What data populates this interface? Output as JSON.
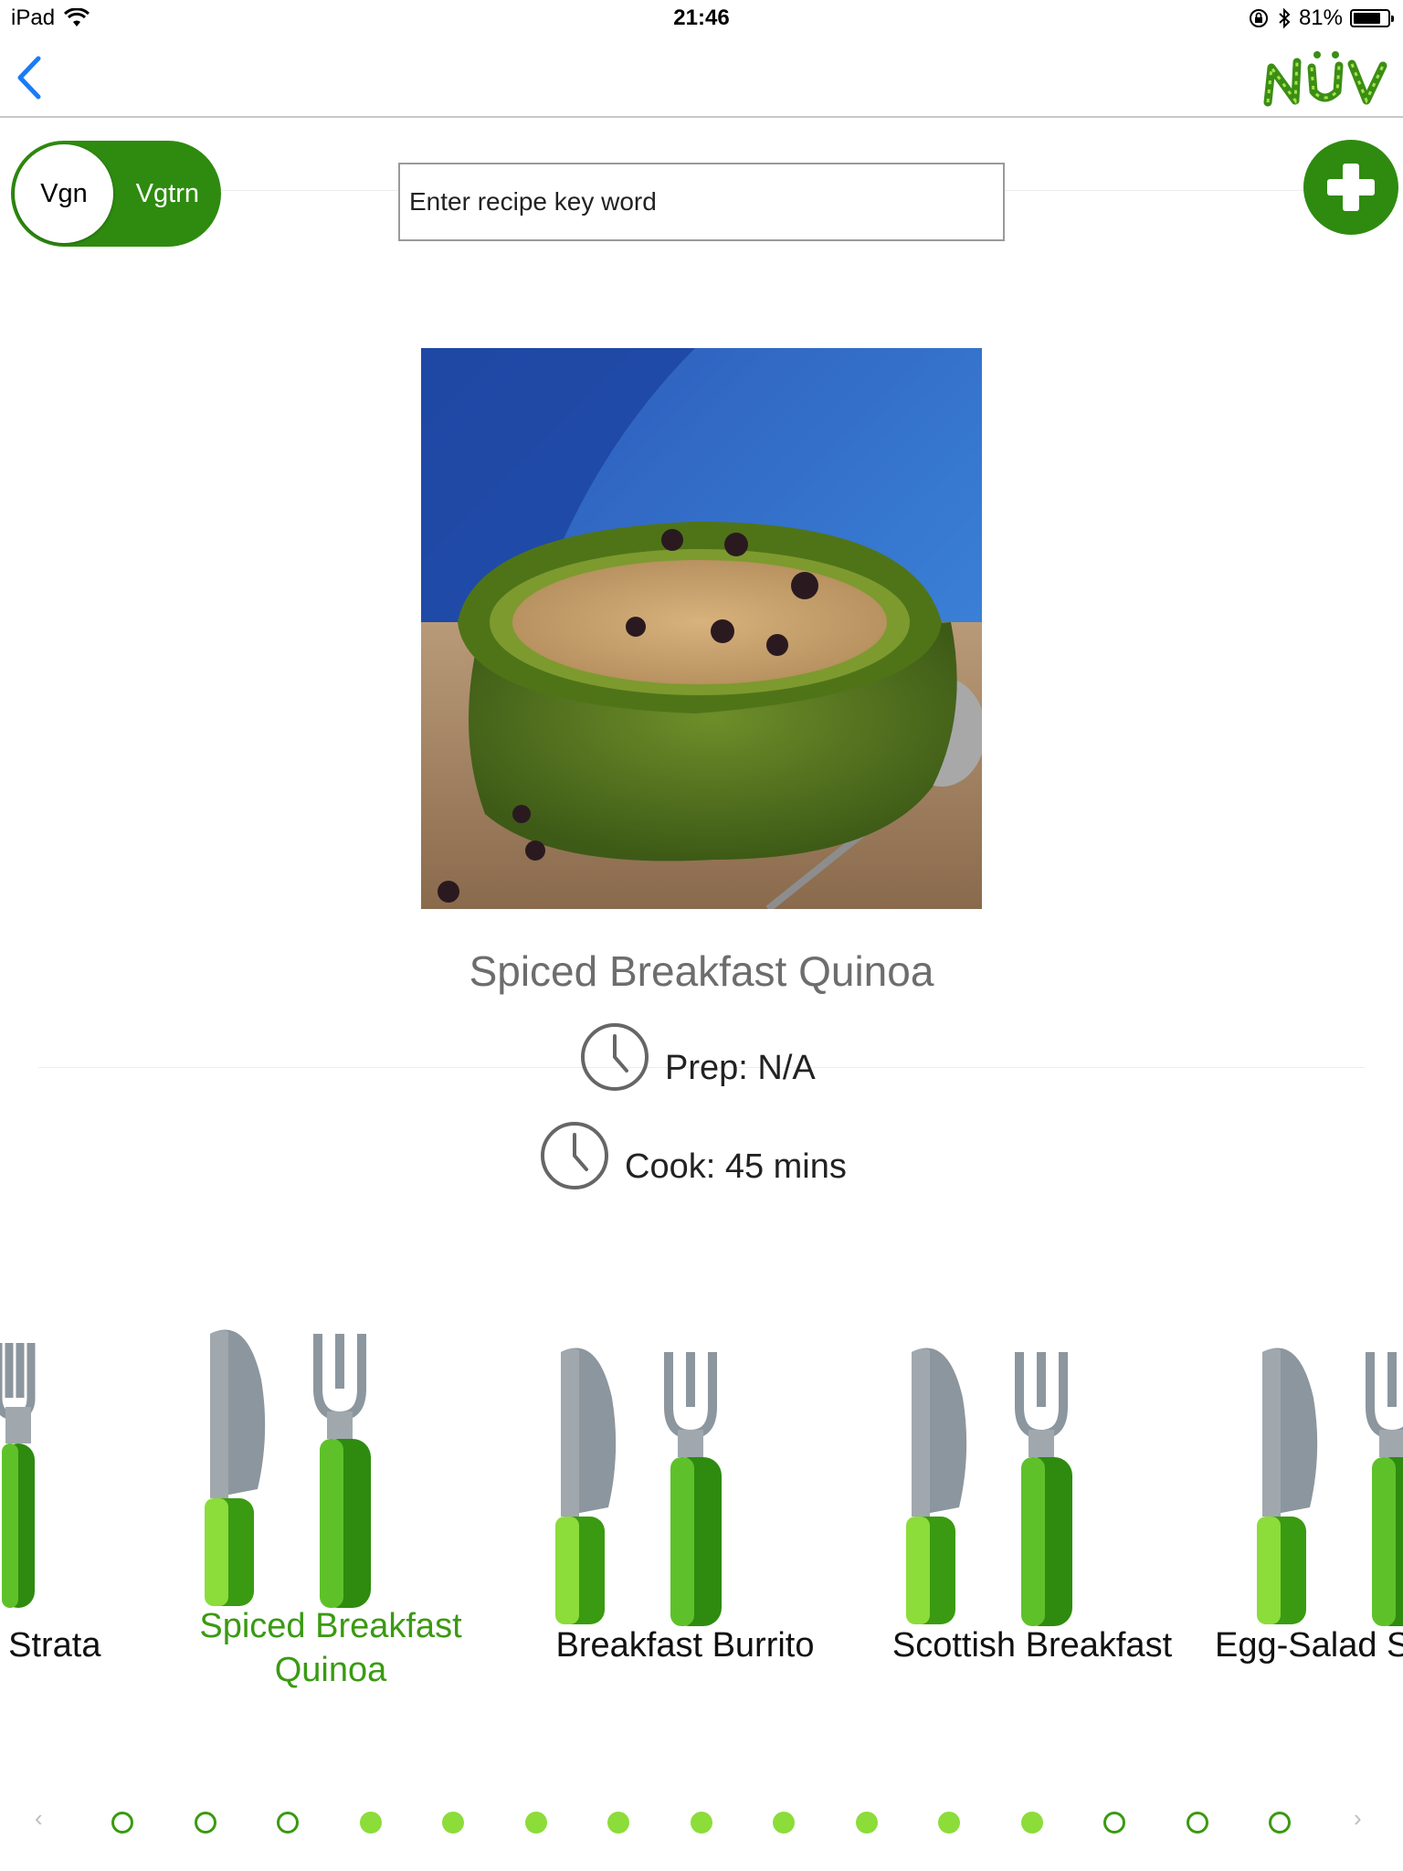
{
  "status_bar": {
    "device": "iPad",
    "time": "21:46",
    "battery": "81%",
    "battery_level": 0.81
  },
  "nav": {
    "logo_text": "NÜV"
  },
  "diet_toggle": {
    "off_label": "Vgn",
    "on_label": "Vgtrn",
    "state": "on"
  },
  "search": {
    "placeholder": "Enter recipe key word"
  },
  "recipe": {
    "title": "Spiced Breakfast Quinoa",
    "prep": "Prep: N/A",
    "cook": "Cook: 45 mins"
  },
  "carousel": {
    "items": [
      {
        "label": ": Strata"
      },
      {
        "label": "Spiced Breakfast Quinoa",
        "active": true
      },
      {
        "label": "Breakfast Burrito"
      },
      {
        "label": "Scottish Breakfast"
      },
      {
        "label": "Egg-Salad S"
      }
    ]
  },
  "pager": {
    "prev": "‹",
    "next": "›",
    "dots": [
      "empty",
      "empty",
      "empty",
      "full",
      "full",
      "full",
      "full",
      "full",
      "full",
      "full",
      "full",
      "full",
      "empty",
      "empty",
      "empty"
    ]
  },
  "colors": {
    "brand_green": "#2e8b0f",
    "active_text": "#3a9a12",
    "ios_blue": "#1a7cf5"
  }
}
